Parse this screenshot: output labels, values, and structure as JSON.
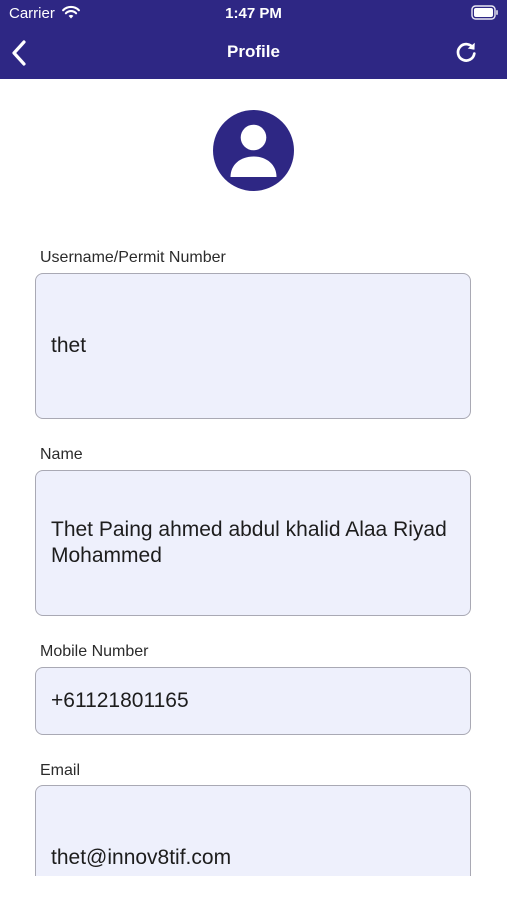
{
  "status_bar": {
    "carrier": "Carrier",
    "time": "1:47 PM"
  },
  "nav": {
    "title": "Profile",
    "back_icon": "chevron-left-icon",
    "refresh_icon": "refresh-icon"
  },
  "avatar": {
    "icon": "user-avatar-icon",
    "color": "#2e2784"
  },
  "fields": {
    "username": {
      "label": "Username/Permit Number",
      "value": "thet"
    },
    "name": {
      "label": "Name",
      "value": "Thet Paing ahmed abdul khalid Alaa Riyad Mohammed"
    },
    "mobile": {
      "label": "Mobile Number",
      "value": "+61121801165"
    },
    "email": {
      "label": "Email",
      "value": "thet@innov8tif.com"
    }
  },
  "colors": {
    "header": "#2e2784",
    "field_background": "#eef0fc",
    "field_border": "#a9a9b4"
  }
}
